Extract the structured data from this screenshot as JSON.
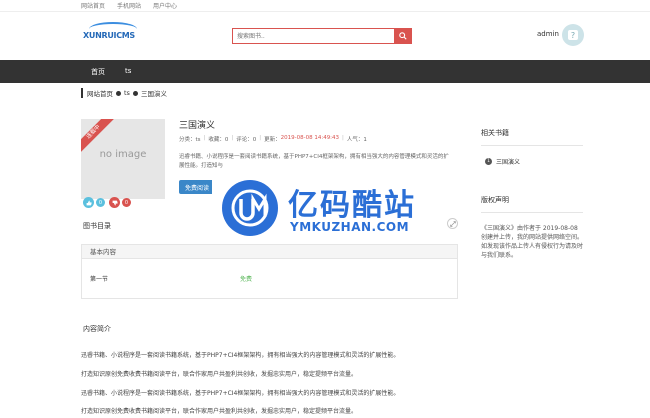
{
  "topbar": {
    "links": [
      "网站首页",
      "手机网站",
      "用户中心"
    ]
  },
  "header": {
    "logo_text": "XUNRUICMS",
    "search_placeholder": "搜索图书..",
    "user_name": "admin"
  },
  "nav": {
    "items": [
      "首页",
      "ts"
    ]
  },
  "breadcrumb": {
    "home": "网站首页",
    "category": "ts",
    "current": "三国演义"
  },
  "book": {
    "cover_text": "no image",
    "ribbon": "连载中",
    "title": "三国演义",
    "meta": {
      "category_label": "分类：ts",
      "collect_label": "收藏：0",
      "comment_label": "评论：0",
      "update_label": "更新：",
      "update_value": "2019-08-08 14:49:43",
      "views_label": "人气：1"
    },
    "description": "迅睿书籍、小说程序是一套阅读书籍系统，基于PHP7+CI4框架架构，拥有相当强大的内容管理模式和灵活的扩展性能。打造知与",
    "read_button": "免费阅读",
    "reactions": {
      "like_count": "0",
      "dislike_count": "0"
    }
  },
  "catalog": {
    "title": "图书目录",
    "box_title": "基本内容",
    "chapters": [
      {
        "name": "第一节",
        "status": "免费"
      }
    ]
  },
  "intro": {
    "title": "内容简介",
    "paragraphs": [
      "迅睿书籍、小说程序是一套阅读书籍系统，基于PHP7+CI4框架架构，拥有相当强大的内容管理模式和灵活的扩展性能。",
      "打造知识原创免费收费书籍阅读平台，联合作家用户共盈利共创收，发掘忠实用户，稳定提频平台流量。",
      "迅睿书籍、小说程序是一套阅读书籍系统，基于PHP7+CI4框架架构，拥有相当强大的内容管理模式和灵活的扩展性能。",
      "打造知识原创免费收费书籍阅读平台，联合作家用户共盈利共创收，发掘忠实用户，稳定提频平台流量。"
    ]
  },
  "sidebar": {
    "related_title": "相关书籍",
    "related_items": [
      {
        "num": "1",
        "title": "三国演义"
      }
    ],
    "copyright_title": "版权声明",
    "copyright_text": "《三国演义》由作者于 2019-08-08 创建并上传，我的网站提供网络空间。如发现该作品上传人有侵权行为请及时与我们联系。"
  },
  "watermark": {
    "cn": "亿码酷站",
    "en": "YMKUZHAN.COM"
  },
  "colors": {
    "accent": "#d9534f",
    "nav_bg": "#333333",
    "button": "#3a87c8",
    "watermark": "#2b6fd6"
  }
}
